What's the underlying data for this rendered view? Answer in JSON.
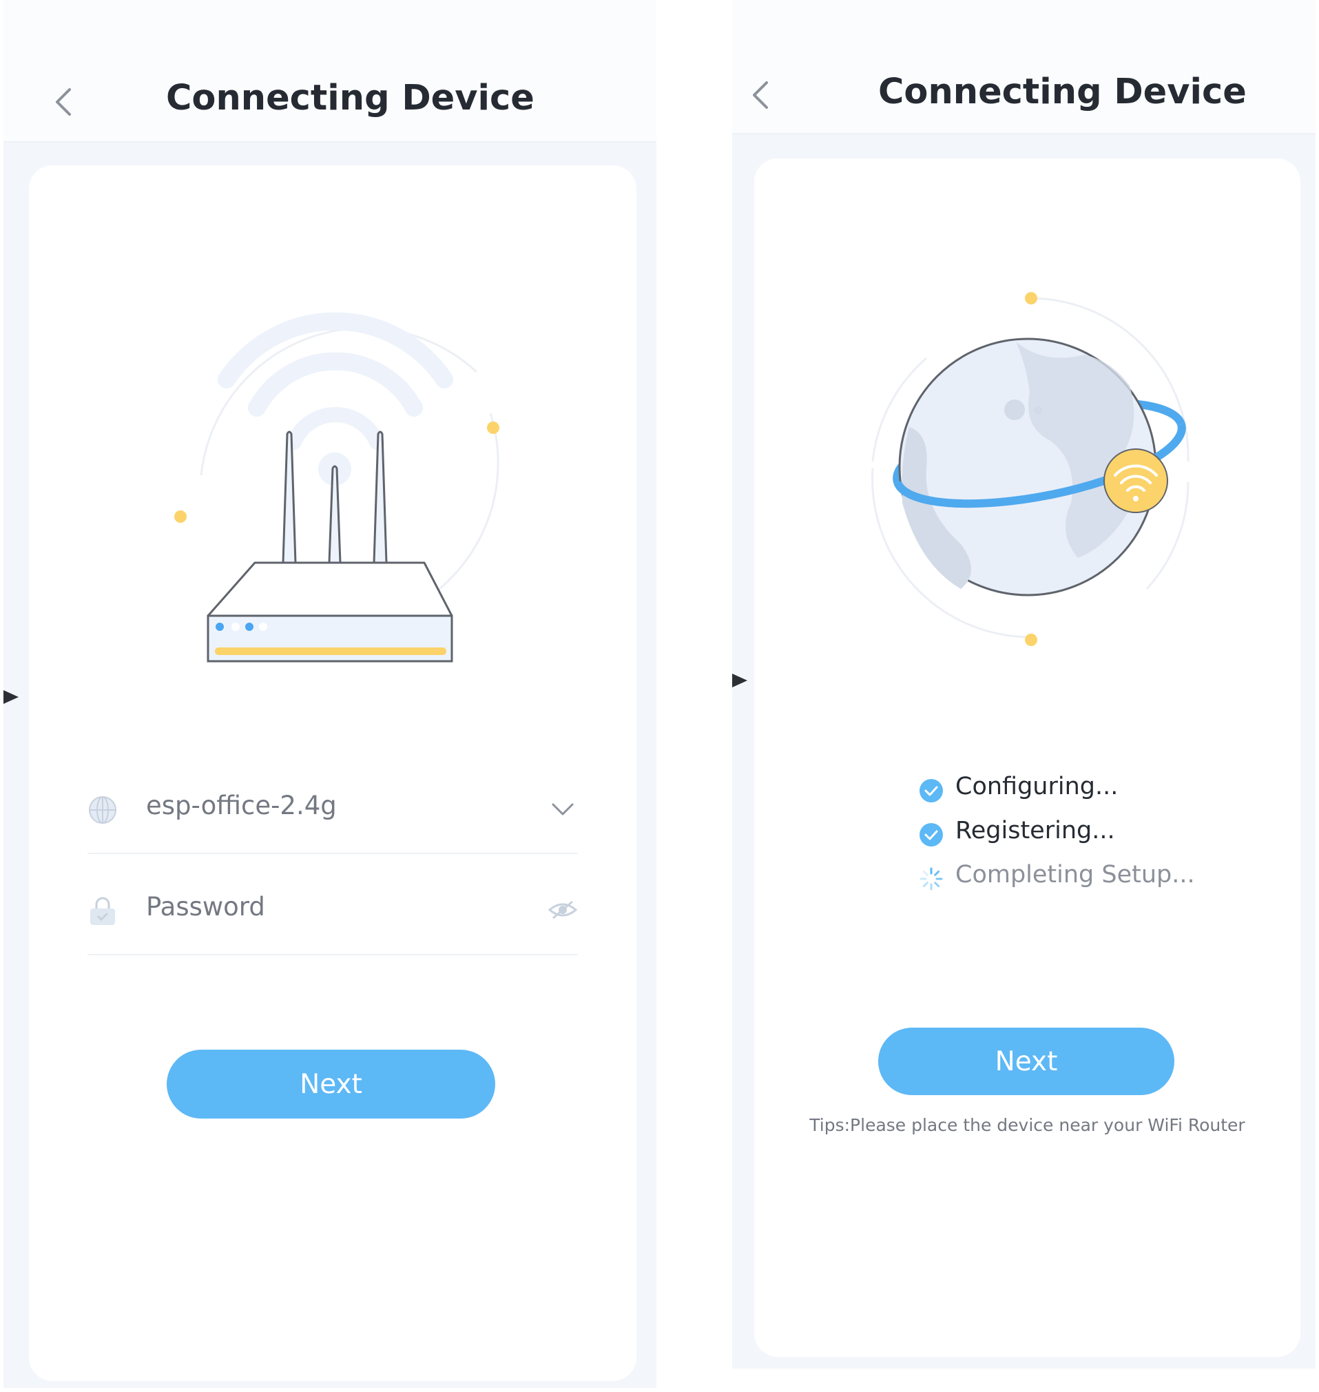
{
  "colors": {
    "accent": "#5db8f6",
    "title_text": "#262b33",
    "yellow_dot": "#fbd36a",
    "done_check": "#5db8f6"
  },
  "left_screen": {
    "header": {
      "title": "Connecting Device",
      "back_icon": "chevron-left-icon"
    },
    "illustration": "wifi-router-illustration",
    "wifi_field": {
      "icon": "globe-icon",
      "value": "esp-office-2.4g",
      "right_icon": "chevron-down-icon"
    },
    "password_field": {
      "icon": "lock-icon",
      "placeholder": "Password",
      "value": "",
      "right_icon": "eye-icon"
    },
    "next_button": {
      "label": "Next"
    }
  },
  "right_screen": {
    "header": {
      "title": "Connecting Device",
      "back_icon": "chevron-left-icon"
    },
    "illustration": "globe-wifi-orbit-illustration",
    "steps": [
      {
        "label": "Configuring...",
        "status": "done",
        "icon": "check-circle-icon"
      },
      {
        "label": "Registering...",
        "status": "done",
        "icon": "check-circle-icon"
      },
      {
        "label": "Completing Setup...",
        "status": "in-progress",
        "icon": "spinner-icon"
      }
    ],
    "next_button": {
      "label": "Next"
    },
    "tip": "Tips:Please place the device near your WiFi Router"
  }
}
